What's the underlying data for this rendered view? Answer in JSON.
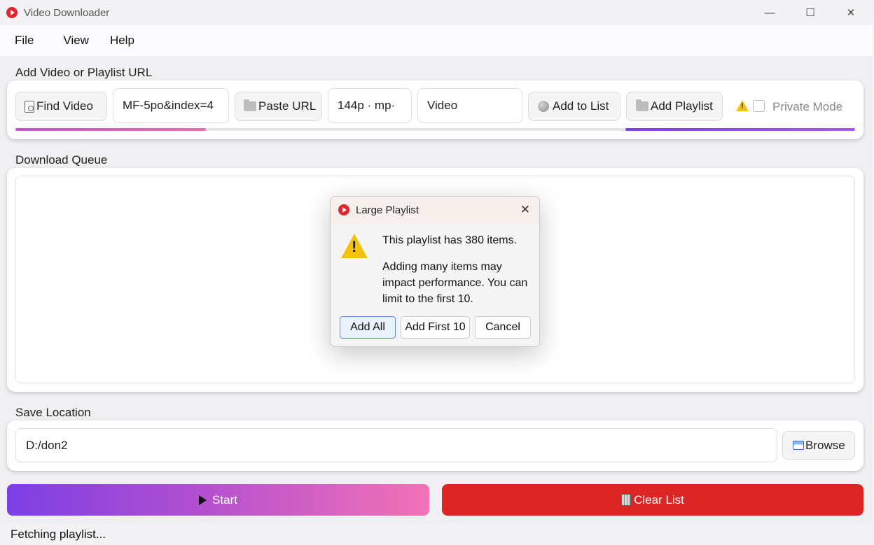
{
  "window": {
    "title": "Video Downloader",
    "minimize_glyph": "—",
    "maximize_glyph": "☐",
    "close_glyph": "✕"
  },
  "menu": [
    "File",
    "View",
    "Help"
  ],
  "url_section": {
    "label": "Add Video or Playlist URL",
    "find_video_label": "Find Video",
    "url_value": "MF-5po&index=4",
    "paste_label": "Paste URL",
    "quality_value": "144p · mp·",
    "type_value": "Video",
    "add_to_list_label": "Add to List",
    "add_playlist_label": "Add Playlist",
    "private_mode_label": "Private Mode"
  },
  "queue_section": {
    "label": "Download Queue"
  },
  "dialog": {
    "title": "Large Playlist",
    "message": "This playlist has 380 items.",
    "detail": "Adding many items may impact performance. You can limit to the first 10.",
    "buttons": {
      "add_all": "Add All",
      "add_first": "Add First 10",
      "cancel": "Cancel"
    }
  },
  "save_section": {
    "label": "Save Location",
    "path_value": "D:/don2",
    "browse_label": "Browse"
  },
  "actions": {
    "start_label": "Start",
    "clear_label": "Clear List"
  },
  "status": {
    "text": "Fetching playlist..."
  },
  "colors": {
    "accent_pink": "#f06aa8",
    "accent_purple": "#7c3fe4",
    "danger_red": "#dc2626",
    "warning_yellow": "#f4c20d"
  }
}
